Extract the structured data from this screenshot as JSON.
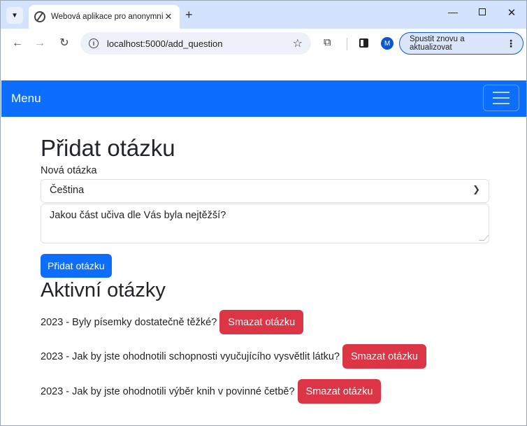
{
  "browser": {
    "tab_title": "Webová aplikace pro anonymní",
    "tab_list_icon": "chevron-down-icon",
    "url": "localhost:5000/add_question",
    "profile_initial": "M",
    "update_button_label": "Spustit znovu a aktualizovat",
    "accent_color": "#0b57d0",
    "tabstrip_color": "#d3e3fd"
  },
  "navbar": {
    "brand": "Menu",
    "color": "#0d6efd"
  },
  "form": {
    "title": "Přidat otázku",
    "label": "Nová otázka",
    "subject_selected": "Čeština",
    "question_text": "Jakou část učiva dle Vás byla nejtěžší?",
    "submit_label": "Přidat otázku",
    "button_color": "#0d6efd"
  },
  "active": {
    "title": "Aktivní otázky",
    "delete_color": "#dc3545",
    "questions": [
      {
        "text": "2023 - Byly písemky dostatečně těžké?",
        "delete_label": "Smazat otázku"
      },
      {
        "text": "2023 - Jak by jste ohodnotili schopnosti vyučujícího vysvětlit látku?",
        "delete_label": "Smazat otázku"
      },
      {
        "text": "2023 - Jak by jste ohodnotili výběr knih v povinné četbě?",
        "delete_label": "Smazat otázku"
      }
    ]
  }
}
